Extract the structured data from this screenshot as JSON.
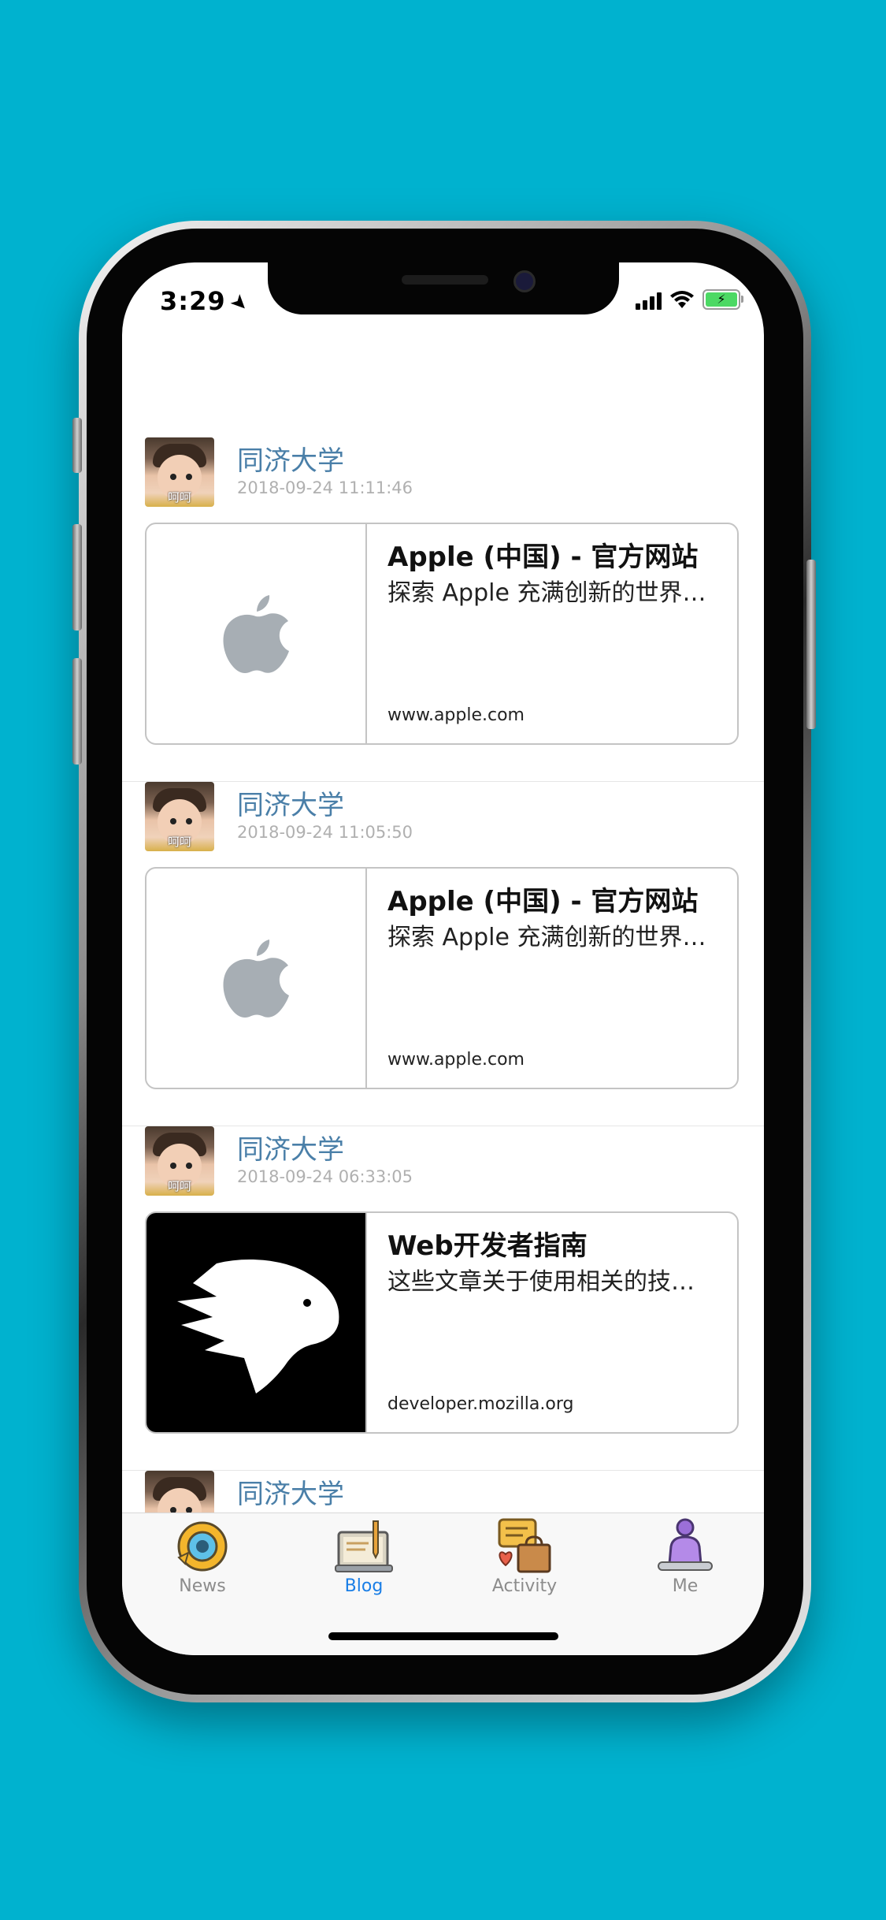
{
  "status_bar": {
    "time": "3:29"
  },
  "feed": {
    "posts": [
      {
        "author": "同济大学",
        "time": "2018-09-24 11:11:46",
        "avatar_caption": "呵呵",
        "card": {
          "title": "Apple (中国) - 官方网站",
          "description": "探索 Apple 充满创新的世界…",
          "url": "www.apple.com",
          "thumb_icon": "apple-logo-icon"
        }
      },
      {
        "author": "同济大学",
        "time": "2018-09-24 11:05:50",
        "avatar_caption": "呵呵",
        "card": {
          "title": "Apple (中国) - 官方网站",
          "description": "探索 Apple 充满创新的世界…",
          "url": "www.apple.com",
          "thumb_icon": "apple-logo-icon"
        }
      },
      {
        "author": "同济大学",
        "time": "2018-09-24 06:33:05",
        "avatar_caption": "呵呵",
        "card": {
          "title": "Web开发者指南",
          "description": "这些文章关于使用相关的技…",
          "url": "developer.mozilla.org",
          "thumb_icon": "mdn-dino-icon"
        }
      },
      {
        "author": "同济大学"
      }
    ]
  },
  "tabbar": {
    "tabs": [
      {
        "label": "News",
        "icon": "news-icon",
        "active": false
      },
      {
        "label": "Blog",
        "icon": "blog-icon",
        "active": true
      },
      {
        "label": "Activity",
        "icon": "activity-icon",
        "active": false
      },
      {
        "label": "Me",
        "icon": "me-icon",
        "active": false
      }
    ],
    "active_color": "#1a7ee6",
    "inactive_color": "#8c8c8c"
  },
  "colors": {
    "background": "#00b2cf",
    "author": "#4a7fa8"
  }
}
